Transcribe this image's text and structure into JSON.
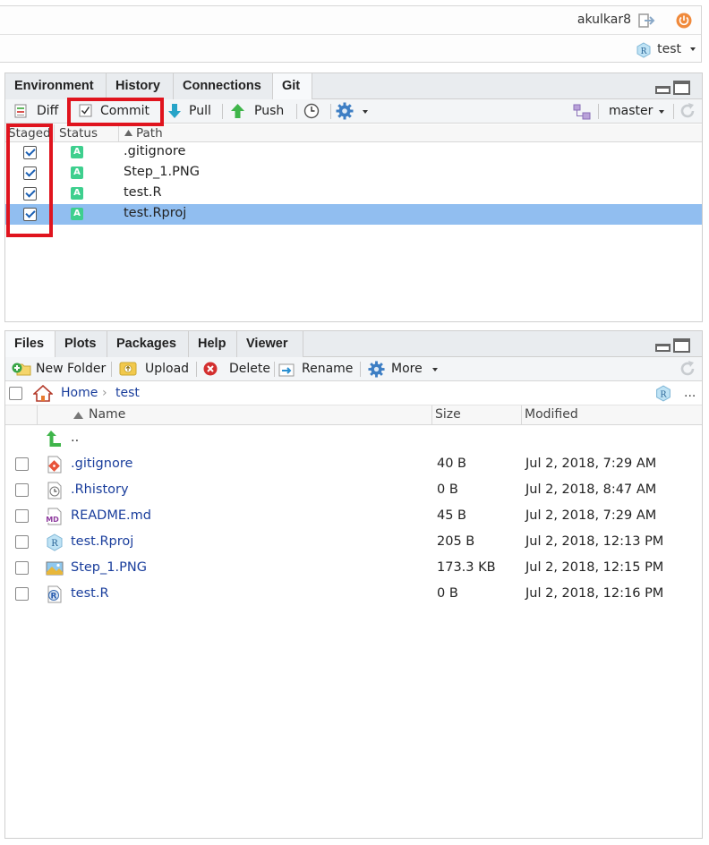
{
  "header": {
    "user": "akulkar8",
    "project": "test"
  },
  "git_pane": {
    "tabs": [
      "Environment",
      "History",
      "Connections",
      "Git"
    ],
    "active_tab": "Git",
    "toolbar": {
      "diff": "Diff",
      "commit": "Commit",
      "pull": "Pull",
      "push": "Push",
      "branch": "master"
    },
    "columns": {
      "staged": "Staged",
      "status": "Status",
      "path": "Path"
    },
    "rows": [
      {
        "path": ".gitignore",
        "status": "A",
        "selected": false
      },
      {
        "path": "Step_1.PNG",
        "status": "A",
        "selected": false
      },
      {
        "path": "test.R",
        "status": "A",
        "selected": false
      },
      {
        "path": "test.Rproj",
        "status": "A",
        "selected": true
      }
    ]
  },
  "files_pane": {
    "tabs": [
      "Files",
      "Plots",
      "Packages",
      "Help",
      "Viewer"
    ],
    "active_tab": "Files",
    "toolbar": {
      "new_folder": "New Folder",
      "upload": "Upload",
      "delete": "Delete",
      "rename": "Rename",
      "more": "More"
    },
    "breadcrumb": {
      "home": "Home",
      "sep": "›",
      "folder": "test",
      "ellipsis": "..."
    },
    "columns": {
      "name": "Name",
      "size": "Size",
      "modified": "Modified"
    },
    "parent_dir": "..",
    "files": [
      {
        "name": ".gitignore",
        "size": "40 B",
        "modified": "Jul 2, 2018, 7:29 AM",
        "icon": "gitignore-file-icon"
      },
      {
        "name": ".Rhistory",
        "size": "0 B",
        "modified": "Jul 2, 2018, 8:47 AM",
        "icon": "history-file-icon"
      },
      {
        "name": "README.md",
        "size": "45 B",
        "modified": "Jul 2, 2018, 7:29 AM",
        "icon": "markdown-file-icon"
      },
      {
        "name": "test.Rproj",
        "size": "205 B",
        "modified": "Jul 2, 2018, 12:13 PM",
        "icon": "rproj-file-icon"
      },
      {
        "name": "Step_1.PNG",
        "size": "173.3 KB",
        "modified": "Jul 2, 2018, 12:15 PM",
        "icon": "image-file-icon"
      },
      {
        "name": "test.R",
        "size": "0 B",
        "modified": "Jul 2, 2018, 12:16 PM",
        "icon": "r-script-file-icon"
      }
    ]
  },
  "colors": {
    "selection": "#91bef0",
    "highlight_red": "#e0141e",
    "status_added": "#3ecf8e",
    "link_blue": "#1a3e9c"
  }
}
